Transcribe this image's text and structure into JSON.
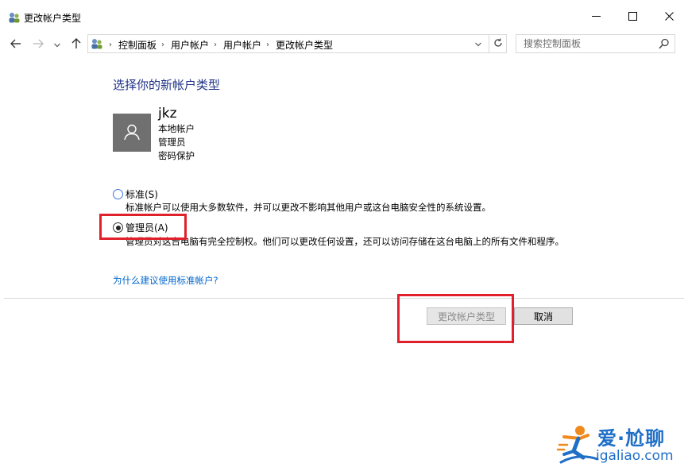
{
  "window": {
    "title": "更改帐户类型",
    "minimize_icon": "minimize-icon",
    "maximize_icon": "maximize-icon",
    "close_icon": "close-icon"
  },
  "navigation": {
    "back_icon": "arrow-left-icon",
    "forward_icon": "arrow-right-icon",
    "recent_icon": "chevron-down-icon",
    "up_icon": "arrow-up-icon",
    "breadcrumbs": [
      "控制面板",
      "用户帐户",
      "用户帐户",
      "更改帐户类型"
    ],
    "separator": "›",
    "refresh_icon": "refresh-icon"
  },
  "search": {
    "placeholder": "搜索控制面板",
    "value": "",
    "icon": "search-icon"
  },
  "main": {
    "heading": "选择你的新帐户类型",
    "user": {
      "name": "jkz",
      "account_type": "本地帐户",
      "role": "管理员",
      "password_state": "密码保护",
      "avatar_icon": "user-icon"
    },
    "options": [
      {
        "label": "标准(S)",
        "description": "标准帐户可以使用大多数软件，并可以更改不影响其他用户或这台电脑安全性的系统设置。",
        "checked": false
      },
      {
        "label": "管理员(A)",
        "description": "管理员对这台电脑有完全控制权。他们可以更改任何设置，还可以访问存储在这台电脑上的所有文件和程序。",
        "checked": true
      }
    ],
    "help_link": "为什么建议使用标准帐户?"
  },
  "buttons": {
    "change_label": "更改帐户类型",
    "change_enabled": false,
    "cancel_label": "取消"
  },
  "annotations": {
    "highlight_color": "#e0202a"
  },
  "watermark": {
    "title": "爱·尬聊",
    "url": "igaliao.com",
    "color": "#1f6fc7"
  },
  "colors": {
    "heading": "#1e3287",
    "link": "#0066cc",
    "avatar_bg": "#707070"
  }
}
